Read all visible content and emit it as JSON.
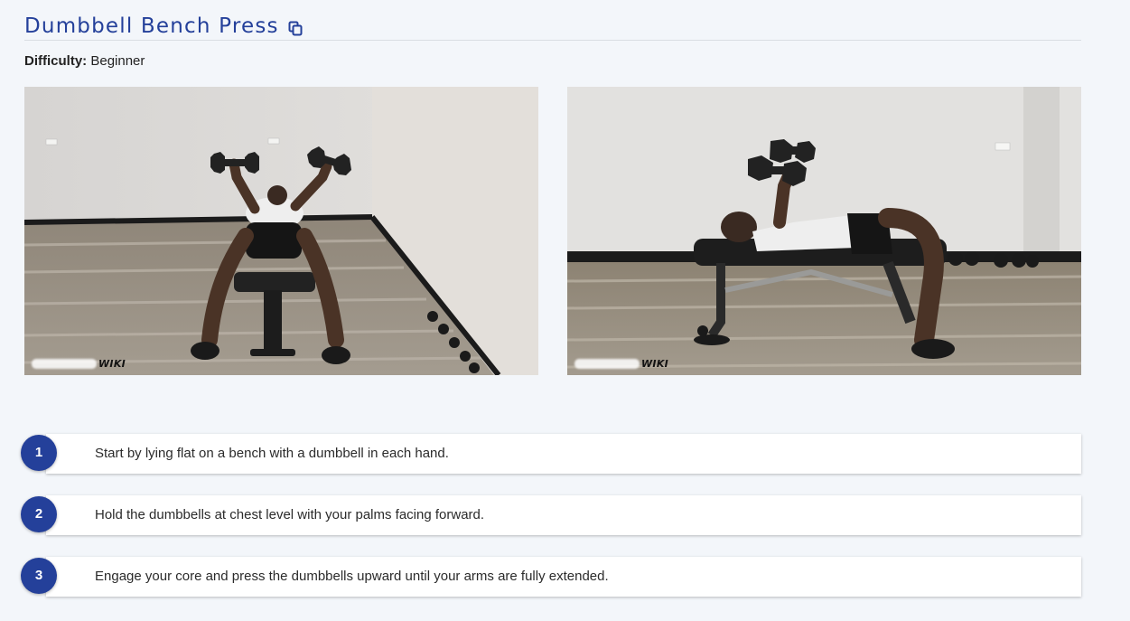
{
  "exercise": {
    "title": "Dumbbell Bench Press",
    "difficulty_label": "Difficulty:",
    "difficulty_value": "Beginner"
  },
  "images": [
    {
      "name": "front-view-photo",
      "watermark": "WIKI"
    },
    {
      "name": "side-view-photo",
      "watermark": "WIKI"
    }
  ],
  "steps": [
    {
      "number": "1",
      "text": "Start by lying flat on a bench with a dumbbell in each hand."
    },
    {
      "number": "2",
      "text": "Hold the dumbbells at chest level with your palms facing forward."
    },
    {
      "number": "3",
      "text": "Engage your core and press the dumbbells upward until your arms are fully extended."
    }
  ],
  "colors": {
    "accent": "#24409a",
    "background": "#f3f6fa",
    "card": "#ffffff"
  },
  "icons": {
    "copy": "copy-icon"
  }
}
